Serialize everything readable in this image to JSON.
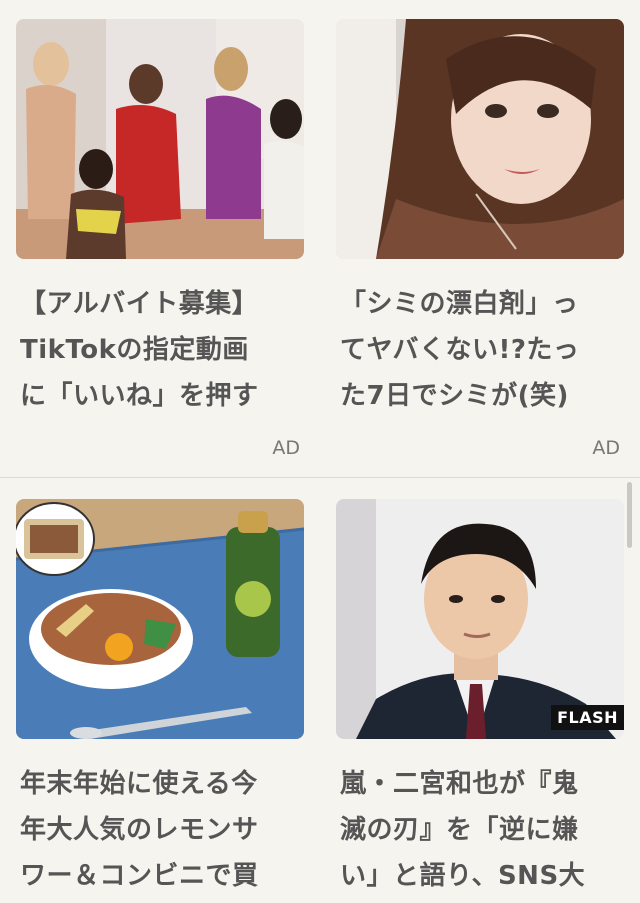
{
  "feed": {
    "cards": [
      {
        "title_lines": [
          "【アルバイト募集】",
          "TikTokの指定動画",
          "に「いいね」を押す"
        ],
        "ad_label": "AD"
      },
      {
        "title_lines": [
          "「シミの漂白剤」っ",
          "てヤバくない!?たっ",
          "た7日でシミが(笑)"
        ],
        "ad_label": "AD"
      },
      {
        "title_lines": [
          "年末年始に使える今",
          "年大人気のレモンサ",
          "ワー＆コンビニで買"
        ]
      },
      {
        "title_lines": [
          "嵐・二宮和也が『鬼",
          "滅の刃』を「逆に嫌",
          "い」と語り、SNS大"
        ],
        "image_watermark": "FLASH"
      }
    ]
  },
  "colors": {
    "background": "#f6f4ee",
    "title_text": "#555555",
    "ad_text": "#777777"
  }
}
